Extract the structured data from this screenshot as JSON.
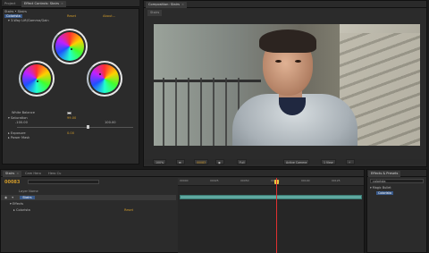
{
  "left_panel": {
    "tabs": [
      "Project",
      "Effect Controls: Stairs"
    ],
    "breadcrumb": "Stairs • Stairs",
    "effect_name": "Colorista",
    "reset": "Reset",
    "about": "About...",
    "section": "3-Way",
    "lift": "Lift/Gamma/Gain",
    "white_balance": "White Balance",
    "saturation": "Saturation",
    "saturation_value": "99.00",
    "sat_min": "-100.00",
    "sat_max": "100.00",
    "exposure": "Exposure",
    "exposure_value": "0.00",
    "power_mask": "Power Mask"
  },
  "comp_panel": {
    "tab": "Composition: Stairs",
    "comp_name": "Stairs",
    "toolbar": {
      "zoom": "100%",
      "timecode": "00083",
      "quality": "Full",
      "camera": "Active Camera",
      "views": "1 View"
    }
  },
  "timeline": {
    "tabs": [
      "Stairs",
      "Cam Hero",
      "Hero Cu"
    ],
    "timecode": "00083",
    "column_header": "Layer Name",
    "layer_name": "Stairs",
    "effects_label": "Effects",
    "effect_name": "Colorista",
    "effect_reset": "Reset",
    "ruler_ticks": [
      "00000",
      "00025",
      "00050",
      "00075",
      "00100",
      "00125"
    ]
  },
  "effects_presets": {
    "tab": "Effects & Presets",
    "search": "colorista",
    "category": "Magic Bullet",
    "item": "Colorista"
  },
  "colors": {
    "accent": "#d09a2a",
    "track": "#5fa8a0",
    "playhead": "#e03030"
  }
}
